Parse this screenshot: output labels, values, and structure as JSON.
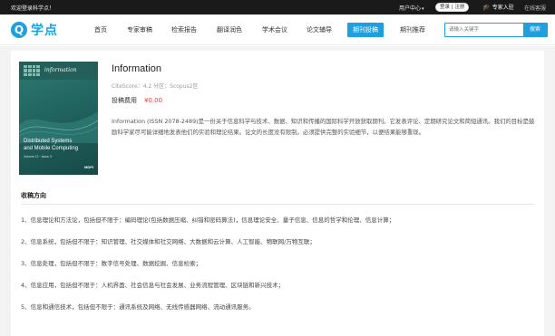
{
  "topbar": {
    "welcome": "欢迎登录科学点！",
    "user_center": "用户中心",
    "auth": "登录 | 注册",
    "expert": "专家入驻",
    "service": "在线客服"
  },
  "header": {
    "logo_mark": "Q",
    "logo_text": "学点",
    "nav": [
      {
        "label": "首页"
      },
      {
        "label": "专家审稿"
      },
      {
        "label": "检索报告"
      },
      {
        "label": "翻译润色"
      },
      {
        "label": "学术会议"
      },
      {
        "label": "论文辅导"
      },
      {
        "label": "期刊投稿"
      },
      {
        "label": "期刊推荐"
      }
    ],
    "active_nav": "期刊投稿",
    "search_placeholder": "请输入关键字",
    "search_button": "搜索"
  },
  "journal": {
    "title": "Information",
    "meta": "CiteScore：4.2 分区：Scopus2区",
    "fee_label": "投稿费用",
    "fee_value": "¥0.00",
    "description": "Information (ISSN 2078-2489)是一份关于信息科学与技术、数据、知识和传播的国际科学开放获取期刊。它发表评论、定期研究论文和简短通讯。我们的目标是鼓励科学家尽可能详细地发表他们的实验和理论结果。论文的长度没有限制。必须提供完整的实验细节，以便结果能够重现。",
    "cover": {
      "journal_name": "information",
      "title_line1": "Distributed Systems",
      "title_line2": "and Mobile Computing",
      "issue": "Volume 12 · Issue 3",
      "publisher": "MDPI"
    }
  },
  "topics": {
    "heading": "收稿方向",
    "items": [
      "1、信息理论和方法论，包括但不限于：编码理论(包括数据压缩、纠错和密码算法)，信息理论安全、量子信息、信息的哲学和伦理、信息计算；",
      "2、信息系统，包括但不限于：知识管理、社交媒体和社交网络、大数据和云计算、人工智能、物联网/万物互联；",
      "3、信息处理，包括但不限于：数字信号处理、数据挖掘、信息检索；",
      "4、信息应用，包括但不限于：人机界面、社会信息与社会发展、业务流程管理、区块链和新兴技术；",
      "5、信息和通信技术，包括但不限于：通讯系统及网络、无线传感器网络、流动通讯服务。"
    ]
  },
  "colors": {
    "brand": "#1e9fe0",
    "price": "#e4393c",
    "topbar": "#1a1a1a"
  }
}
